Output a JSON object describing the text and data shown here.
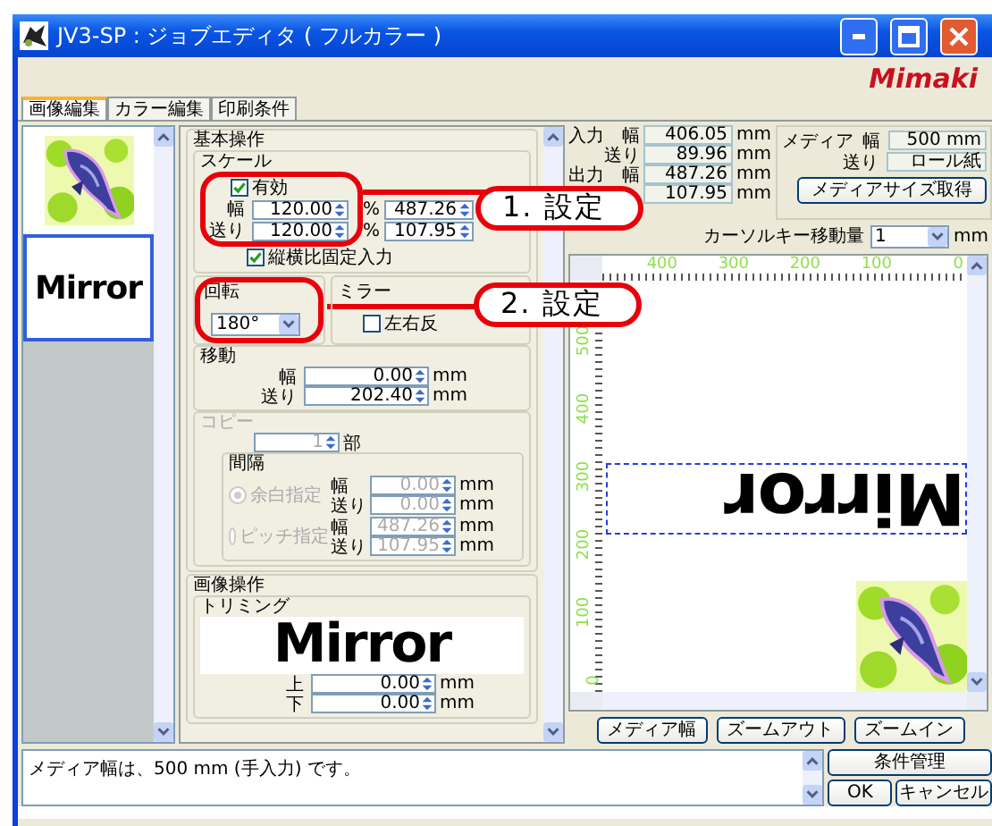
{
  "window": {
    "title": "JV3-SP : ジョブエディタ ( フルカラー )",
    "logo": "Mimaki"
  },
  "tabs": [
    {
      "label": "画像編集",
      "selected": true
    },
    {
      "label": "カラー編集",
      "selected": false
    },
    {
      "label": "印刷条件",
      "selected": false
    }
  ],
  "job_list": {
    "items": [
      {
        "kind": "picture",
        "selected": false
      },
      {
        "kind": "text",
        "label": "Mirror",
        "selected": true
      }
    ]
  },
  "basic": {
    "title": "基本操作",
    "scale": {
      "title": "スケール",
      "enabled_label": "有効",
      "enabled": true,
      "rows": [
        {
          "label": "幅",
          "value": "120.00",
          "unit": "%",
          "value2": "487.26"
        },
        {
          "label": "送り",
          "value": "120.00",
          "unit": "%",
          "value2": "107.95"
        }
      ],
      "lock_label": "縦横比固定入力",
      "lock": true
    },
    "rotation": {
      "title": "回転",
      "value": "180°"
    },
    "mirror": {
      "title": "ミラー",
      "option": "左右反",
      "checked": false
    },
    "move": {
      "title": "移動",
      "rows": [
        {
          "label": "幅",
          "value": "0.00",
          "unit": "mm"
        },
        {
          "label": "送り",
          "value": "202.40",
          "unit": "mm"
        }
      ]
    },
    "copy": {
      "title": "コピー",
      "disabled": true,
      "count": "1",
      "count_unit": "部",
      "spacing_title": "間隔",
      "options": [
        {
          "label": "余白指定",
          "selected": true,
          "rows": [
            {
              "label": "幅",
              "value": "0.00",
              "unit": "mm"
            },
            {
              "label": "送り",
              "value": "0.00",
              "unit": "mm"
            }
          ]
        },
        {
          "label": "ピッチ指定",
          "selected": false,
          "rows": [
            {
              "label": "幅",
              "value": "487.26",
              "unit": "mm"
            },
            {
              "label": "送り",
              "value": "107.95",
              "unit": "mm"
            }
          ]
        }
      ]
    }
  },
  "image_ops": {
    "title": "画像操作",
    "trimming": {
      "title": "トリミング",
      "preview": "Mirror",
      "rows": [
        {
          "label": "上",
          "value": "0.00",
          "unit": "mm"
        },
        {
          "label": "下",
          "value": "0.00",
          "unit": "mm"
        }
      ]
    }
  },
  "input": {
    "label": "入力",
    "rows": [
      {
        "label": "幅",
        "value": "406.05",
        "unit": "mm"
      },
      {
        "label": "送り",
        "value": "89.96",
        "unit": "mm"
      }
    ]
  },
  "output": {
    "label": "出力",
    "rows": [
      {
        "label": "幅",
        "value": "487.26",
        "unit": "mm"
      },
      {
        "value": "107.95",
        "unit": "mm"
      }
    ]
  },
  "media": {
    "label": "メディア",
    "rows": [
      {
        "label": "幅",
        "value": "500 mm"
      },
      {
        "label": "送り",
        "value": "ロール紙"
      }
    ],
    "button": "メディアサイズ取得"
  },
  "cursor": {
    "label": "カーソルキー移動量",
    "value": "1",
    "unit": "mm"
  },
  "ruler": {
    "x_labels": [
      "400",
      "300",
      "200",
      "100",
      "0"
    ],
    "y_labels": [
      "500",
      "400",
      "300",
      "200",
      "100",
      "0"
    ]
  },
  "canvas": {
    "text": "Mirror"
  },
  "view_buttons": [
    "メディア幅",
    "ズームアウト",
    "ズームイン"
  ],
  "status": {
    "message": "メディア幅は、500 mm (手入力) です。",
    "buttons": [
      "条件管理",
      "OK",
      "キャンセル"
    ]
  },
  "callouts": [
    "1. 設定",
    "2. 設定"
  ]
}
